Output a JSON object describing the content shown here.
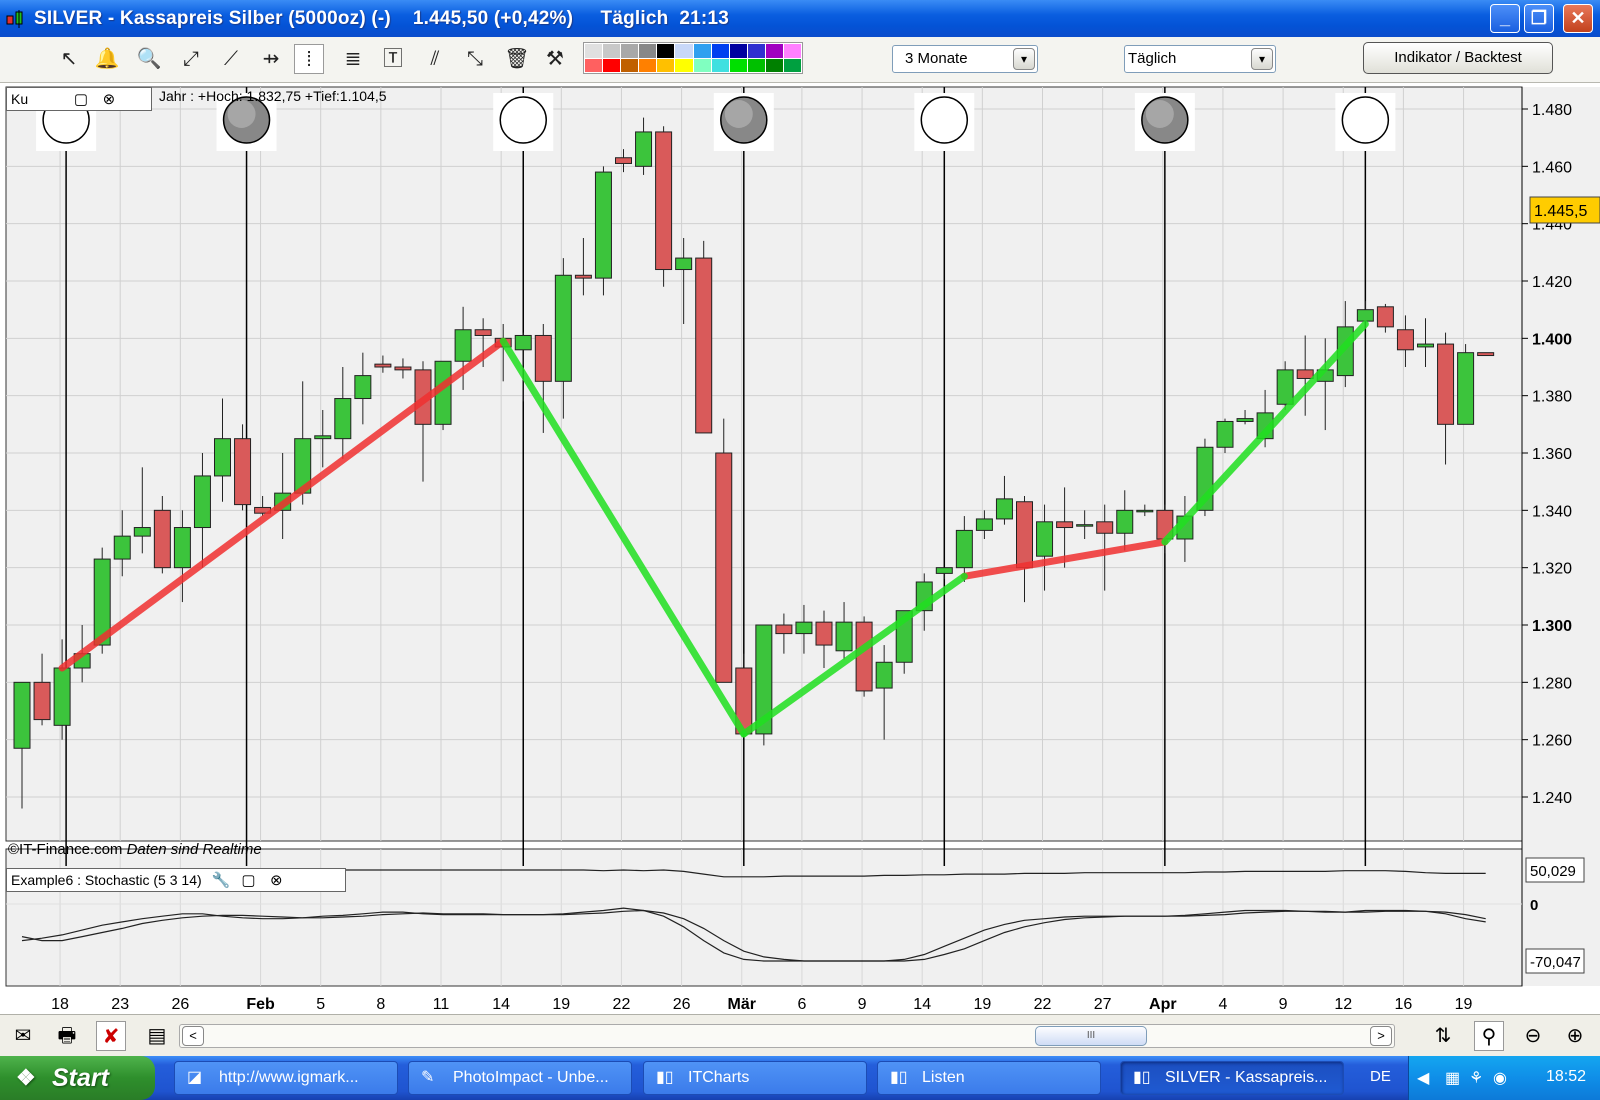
{
  "window": {
    "title": "SILVER - Kassapreis Silber (5000oz) (-)    1.445,50 (+0,42%)     Täglich  21:13",
    "buttons": {
      "minimize": "_",
      "maximize": "❐",
      "close": "✕"
    }
  },
  "toolbar": {
    "tools": [
      "cursor-icon",
      "alarm-icon",
      "zoom-icon",
      "trendline-icon",
      "line-icon",
      "hline-icon",
      "vline-icon",
      "fibonacci-icon",
      "text-icon",
      "channel-icon",
      "arrow-icon",
      "trash-icon",
      "settings-icon"
    ],
    "period_select": "3 Monate",
    "interval_select": "Täglich",
    "indicator_button": "Indikator / Backtest",
    "palette_colors": [
      "#e0e0e0",
      "#c8c8c8",
      "#a8a8a8",
      "#888888",
      "#000000",
      "#c8d8f8",
      "#30a0f0",
      "#0040f0",
      "#0000a0",
      "#3030d0",
      "#a000c0",
      "#ff80ff",
      "#ff6060",
      "#ff0000",
      "#c06000",
      "#ff8000",
      "#ffc000",
      "#ffff00",
      "#80ffc0",
      "#40e0e0",
      "#00e000",
      "#00c000",
      "#008000",
      "#00a040"
    ]
  },
  "main_panel": {
    "header": "Jahr : +Hoch: 1.832,75 +Tief:1.104,5",
    "header_prefix": "Ku",
    "copyright": "©IT-Finance.com",
    "realtime_note": "Daten sind Realtime",
    "current_price_label": "1.445,5",
    "accent_price_color": "#ffcc00",
    "up_color": "#3cc43c",
    "down_color": "#d95a5a",
    "y_ticks": [
      "1.480",
      "1.460",
      "1.440",
      "1.420",
      "1.400",
      "1.380",
      "1.360",
      "1.340",
      "1.320",
      "1.300",
      "1.280",
      "1.260",
      "1.240"
    ],
    "y_ticks_bold": [
      "1.400",
      "1.300"
    ],
    "moon_phases": [
      "full",
      "new",
      "full",
      "new",
      "full",
      "new",
      "full"
    ]
  },
  "stoch_panel": {
    "header": "Example6 : Stochastic (5 3 14)",
    "labels": {
      "top": "50,029",
      "zero": "0",
      "bottom": "-70,047"
    }
  },
  "x_axis": {
    "labels": [
      "18",
      "23",
      "26",
      "Feb",
      "5",
      "8",
      "11",
      "14",
      "19",
      "22",
      "26",
      "Mär",
      "6",
      "9",
      "14",
      "19",
      "22",
      "27",
      "Apr",
      "4",
      "9",
      "12",
      "16",
      "19"
    ],
    "bold": [
      "Feb",
      "Mär",
      "Apr"
    ]
  },
  "chart_data": {
    "type": "candlestick",
    "title": "SILVER - Kassapreis Silber (5000oz)",
    "interval": "Täglich",
    "range": "3 Monate",
    "ylim": [
      1230,
      1485
    ],
    "candles": [
      {
        "o": 1257,
        "h": 1278,
        "l": 1236,
        "c": 1280
      },
      {
        "o": 1280,
        "h": 1290,
        "l": 1265,
        "c": 1267
      },
      {
        "o": 1265,
        "h": 1295,
        "l": 1260,
        "c": 1285
      },
      {
        "o": 1285,
        "h": 1300,
        "l": 1280,
        "c": 1290
      },
      {
        "o": 1293,
        "h": 1327,
        "l": 1290,
        "c": 1323
      },
      {
        "o": 1323,
        "h": 1340,
        "l": 1317,
        "c": 1331
      },
      {
        "o": 1331,
        "h": 1355,
        "l": 1325,
        "c": 1334
      },
      {
        "o": 1340,
        "h": 1345,
        "l": 1318,
        "c": 1320
      },
      {
        "o": 1320,
        "h": 1340,
        "l": 1308,
        "c": 1334
      },
      {
        "o": 1334,
        "h": 1360,
        "l": 1320,
        "c": 1352
      },
      {
        "o": 1352,
        "h": 1379,
        "l": 1343,
        "c": 1365
      },
      {
        "o": 1365,
        "h": 1370,
        "l": 1340,
        "c": 1342
      },
      {
        "o": 1341,
        "h": 1345,
        "l": 1338,
        "c": 1339
      },
      {
        "o": 1340,
        "h": 1360,
        "l": 1330,
        "c": 1346
      },
      {
        "o": 1346,
        "h": 1385,
        "l": 1342,
        "c": 1365
      },
      {
        "o": 1365,
        "h": 1375,
        "l": 1355,
        "c": 1366
      },
      {
        "o": 1365,
        "h": 1390,
        "l": 1358,
        "c": 1379
      },
      {
        "o": 1379,
        "h": 1395,
        "l": 1370,
        "c": 1387
      },
      {
        "o": 1391,
        "h": 1394,
        "l": 1388,
        "c": 1390
      },
      {
        "o": 1390,
        "h": 1393,
        "l": 1386,
        "c": 1389
      },
      {
        "o": 1389,
        "h": 1392,
        "l": 1350,
        "c": 1370
      },
      {
        "o": 1370,
        "h": 1385,
        "l": 1368,
        "c": 1392
      },
      {
        "o": 1392,
        "h": 1411,
        "l": 1382,
        "c": 1403
      },
      {
        "o": 1403,
        "h": 1407,
        "l": 1390,
        "c": 1401
      },
      {
        "o": 1400,
        "h": 1405,
        "l": 1385,
        "c": 1397
      },
      {
        "o": 1396,
        "h": 1402,
        "l": 1378,
        "c": 1401
      },
      {
        "o": 1401,
        "h": 1405,
        "l": 1367,
        "c": 1385
      },
      {
        "o": 1385,
        "h": 1428,
        "l": 1372,
        "c": 1422
      },
      {
        "o": 1422,
        "h": 1435,
        "l": 1415,
        "c": 1421
      },
      {
        "o": 1421,
        "h": 1460,
        "l": 1415,
        "c": 1458
      },
      {
        "o": 1463,
        "h": 1466,
        "l": 1458,
        "c": 1461
      },
      {
        "o": 1460,
        "h": 1477,
        "l": 1457,
        "c": 1472
      },
      {
        "o": 1472,
        "h": 1474,
        "l": 1418,
        "c": 1424
      },
      {
        "o": 1424,
        "h": 1435,
        "l": 1405,
        "c": 1428
      },
      {
        "o": 1428,
        "h": 1434,
        "l": 1372,
        "c": 1367
      },
      {
        "o": 1360,
        "h": 1372,
        "l": 1308,
        "c": 1280
      },
      {
        "o": 1285,
        "h": 1290,
        "l": 1262,
        "c": 1262
      },
      {
        "o": 1262,
        "h": 1300,
        "l": 1258,
        "c": 1300
      },
      {
        "o": 1300,
        "h": 1304,
        "l": 1290,
        "c": 1297
      },
      {
        "o": 1297,
        "h": 1307,
        "l": 1290,
        "c": 1301
      },
      {
        "o": 1301,
        "h": 1305,
        "l": 1285,
        "c": 1293
      },
      {
        "o": 1291,
        "h": 1308,
        "l": 1288,
        "c": 1301
      },
      {
        "o": 1301,
        "h": 1303,
        "l": 1275,
        "c": 1277
      },
      {
        "o": 1278,
        "h": 1293,
        "l": 1260,
        "c": 1287
      },
      {
        "o": 1287,
        "h": 1300,
        "l": 1283,
        "c": 1305
      },
      {
        "o": 1305,
        "h": 1318,
        "l": 1298,
        "c": 1315
      },
      {
        "o": 1318,
        "h": 1320,
        "l": 1316,
        "c": 1320
      },
      {
        "o": 1320,
        "h": 1338,
        "l": 1315,
        "c": 1333
      },
      {
        "o": 1333,
        "h": 1340,
        "l": 1330,
        "c": 1337
      },
      {
        "o": 1337,
        "h": 1352,
        "l": 1335,
        "c": 1344
      },
      {
        "o": 1343,
        "h": 1345,
        "l": 1308,
        "c": 1320
      },
      {
        "o": 1324,
        "h": 1342,
        "l": 1312,
        "c": 1336
      },
      {
        "o": 1336,
        "h": 1348,
        "l": 1320,
        "c": 1334
      },
      {
        "o": 1335,
        "h": 1340,
        "l": 1330,
        "c": 1335
      },
      {
        "o": 1336,
        "h": 1342,
        "l": 1312,
        "c": 1332
      },
      {
        "o": 1332,
        "h": 1347,
        "l": 1326,
        "c": 1340
      },
      {
        "o": 1340,
        "h": 1342,
        "l": 1338,
        "c": 1340
      },
      {
        "o": 1340,
        "h": 1342,
        "l": 1325,
        "c": 1330
      },
      {
        "o": 1330,
        "h": 1345,
        "l": 1322,
        "c": 1338
      },
      {
        "o": 1340,
        "h": 1365,
        "l": 1338,
        "c": 1362
      },
      {
        "o": 1362,
        "h": 1372,
        "l": 1360,
        "c": 1371
      },
      {
        "o": 1371,
        "h": 1375,
        "l": 1370,
        "c": 1372
      },
      {
        "o": 1365,
        "h": 1382,
        "l": 1362,
        "c": 1374
      },
      {
        "o": 1377,
        "h": 1392,
        "l": 1375,
        "c": 1389
      },
      {
        "o": 1389,
        "h": 1401,
        "l": 1373,
        "c": 1386
      },
      {
        "o": 1385,
        "h": 1400,
        "l": 1368,
        "c": 1389
      },
      {
        "o": 1387,
        "h": 1413,
        "l": 1383,
        "c": 1404
      },
      {
        "o": 1406,
        "h": 1413,
        "l": 1404,
        "c": 1410
      },
      {
        "o": 1411,
        "h": 1412,
        "l": 1402,
        "c": 1404
      },
      {
        "o": 1403,
        "h": 1408,
        "l": 1390,
        "c": 1396
      },
      {
        "o": 1397,
        "h": 1407,
        "l": 1390,
        "c": 1398
      },
      {
        "o": 1398,
        "h": 1402,
        "l": 1356,
        "c": 1370
      },
      {
        "o": 1370,
        "h": 1398,
        "l": 1370,
        "c": 1395
      },
      {
        "o": 1395,
        "h": 1395,
        "l": 1394,
        "c": 1394
      }
    ],
    "red_trend_segments": [
      [
        2,
        1285,
        24,
        1399
      ],
      [
        47,
        1317,
        57,
        1329
      ]
    ],
    "green_trend_segments": [
      [
        24,
        1399,
        36,
        1262
      ],
      [
        36,
        1262,
        47,
        1317
      ],
      [
        57,
        1329,
        67,
        1405
      ]
    ],
    "moon_markers": [
      {
        "i": 2,
        "phase": "full"
      },
      {
        "i": 11,
        "phase": "new"
      },
      {
        "i": 25,
        "phase": "full"
      },
      {
        "i": 36,
        "phase": "new"
      },
      {
        "i": 46,
        "phase": "full"
      },
      {
        "i": 57,
        "phase": "new"
      },
      {
        "i": 67,
        "phase": "full"
      }
    ],
    "stochastic_top": [
      50,
      50,
      50,
      50,
      50,
      50,
      50,
      50,
      50,
      50,
      50,
      50,
      50,
      50,
      50,
      50,
      50,
      50,
      50,
      50,
      50,
      50,
      50,
      50,
      50,
      50,
      50,
      50,
      50,
      49,
      50,
      49,
      50,
      48,
      44,
      40,
      40,
      40,
      41,
      41,
      41,
      41,
      41,
      42,
      42,
      43,
      43,
      44,
      44,
      44,
      45,
      45,
      45,
      46,
      46,
      46,
      46,
      46,
      46,
      47,
      47,
      48,
      48,
      48,
      48,
      48,
      49,
      49,
      49,
      48,
      46,
      45,
      45,
      45
    ],
    "stochastic_k": [
      -45,
      -42,
      -38,
      -32,
      -26,
      -22,
      -18,
      -15,
      -12,
      -12,
      -15,
      -17,
      -18,
      -18,
      -17,
      -15,
      -14,
      -12,
      -10,
      -10,
      -12,
      -13,
      -13,
      -13,
      -13,
      -13,
      -13,
      -12,
      -10,
      -8,
      -5,
      -8,
      -15,
      -28,
      -45,
      -60,
      -68,
      -70,
      -70,
      -70,
      -70,
      -70,
      -70,
      -70,
      -68,
      -62,
      -52,
      -42,
      -32,
      -25,
      -20,
      -18,
      -16,
      -15,
      -15,
      -15,
      -15,
      -15,
      -14,
      -12,
      -10,
      -8,
      -8,
      -8,
      -9,
      -10,
      -10,
      -8,
      -8,
      -8,
      -9,
      -12,
      -18,
      -22
    ],
    "stochastic_d": [
      -40,
      -45,
      -45,
      -40,
      -35,
      -30,
      -24,
      -20,
      -17,
      -15,
      -14,
      -14,
      -15,
      -16,
      -17,
      -17,
      -16,
      -15,
      -13,
      -12,
      -11,
      -12,
      -12,
      -12,
      -13,
      -13,
      -13,
      -13,
      -12,
      -11,
      -9,
      -8,
      -11,
      -18,
      -30,
      -45,
      -58,
      -65,
      -68,
      -70,
      -70,
      -70,
      -70,
      -70,
      -70,
      -68,
      -62,
      -55,
      -45,
      -35,
      -28,
      -23,
      -19,
      -17,
      -16,
      -15,
      -15,
      -15,
      -15,
      -14,
      -13,
      -11,
      -10,
      -9,
      -9,
      -9,
      -10,
      -10,
      -9,
      -9,
      -9,
      -10,
      -13,
      -18
    ]
  },
  "bottom_bar": {
    "icons": [
      "mail-icon",
      "print-icon",
      "delete-drawing-icon",
      "sheet-icon",
      "chart-type-icon",
      "zoom-fit-icon",
      "zoom-out-icon",
      "zoom-in-icon"
    ],
    "scroll_grip": "III",
    "left_arrow": "<",
    "right_arrow": ">"
  },
  "taskbar": {
    "start_label": "Start",
    "tasks": [
      "http://www.igmark...",
      "PhotoImpact - Unbe...",
      "ITCharts",
      "Listen",
      "SILVER - Kassapreis..."
    ],
    "language": "DE",
    "time": "18:52"
  }
}
